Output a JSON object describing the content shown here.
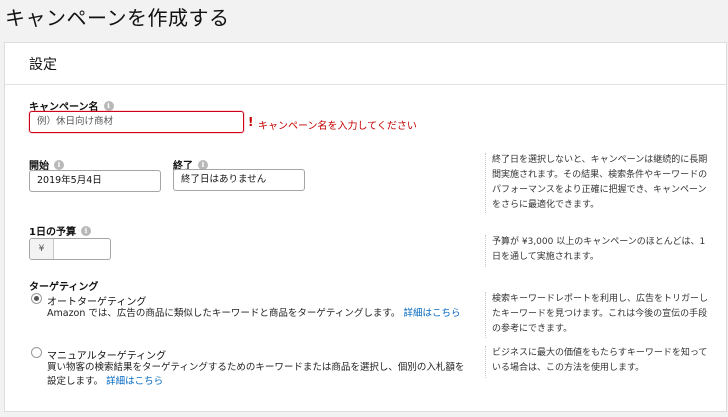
{
  "page": {
    "title": "キャンペーンを作成する"
  },
  "settings": {
    "title": "設定",
    "campaign_name": {
      "label": "キャンペーン名",
      "placeholder": "例）休日向け商材",
      "error": "キャンペーン名を入力してください"
    },
    "start": {
      "label": "開始",
      "value": "2019年5月4日"
    },
    "end": {
      "label": "終了",
      "value": "終了日はありません"
    },
    "end_help": "終了日を選択しないと、キャンペーンは継続的に長期間実施されます。その結果、検索条件やキーワードのパフォーマンスをより正確に把握でき、キャンペーンをさらに最適化できます。",
    "budget": {
      "label": "1日の予算",
      "currency": "¥",
      "value": "",
      "help": "予算が ¥3,000 以上のキャンペーンのほとんどは、1日を通して実施されます。"
    },
    "targeting": {
      "label": "ターゲティング",
      "auto": {
        "label": "オートターゲティング",
        "selected": true,
        "desc": "Amazon では、広告の商品に類似したキーワードと商品をターゲティングします。",
        "link": "詳細はこちら",
        "help": "検索キーワードレポートを利用し、広告をトリガーしたキーワードを見つけます。これは今後の宣伝の手段の参考にできます。"
      },
      "manual": {
        "label": "マニュアルターゲティング",
        "selected": false,
        "desc": "買い物客の検索結果をターゲティングするためのキーワードまたは商品を選択し、個別の入札額を設定します。",
        "link": "詳細はこちら",
        "help": "ビジネスに最大の価値をもたらすキーワードを知っている場合は、この方法を使用します。"
      }
    }
  },
  "icons": {
    "info": "info-icon"
  },
  "colors": {
    "error": "#c40000",
    "link": "#0066c0"
  }
}
